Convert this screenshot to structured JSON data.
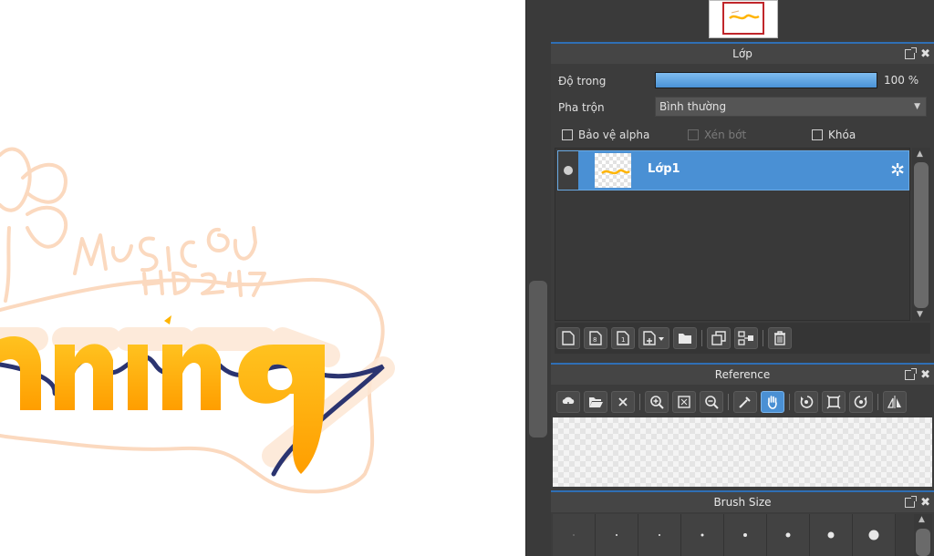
{
  "layer_panel": {
    "title": "Lớp",
    "opacity_label": "Độ trong",
    "opacity_value": "100 %",
    "opacity_level": 1.0,
    "blend_label": "Pha trộn",
    "blend_mode": "Bình thường",
    "protect_alpha_label": "Bảo vệ alpha",
    "clipping_label": "Xén bớt",
    "lock_label": "Khóa",
    "layers": [
      {
        "name": "Lớp1",
        "selected": true
      }
    ]
  },
  "reference_panel": {
    "title": "Reference"
  },
  "brush_panel": {
    "title": "Brush Size"
  },
  "colors": {
    "accent": "#4a90d4",
    "panel_bg": "#3c3c3c",
    "header_bg": "#454545",
    "lettering_yellow": "#ffb400",
    "lettering_navy": "#2b3470",
    "sketch_peach": "#fbd9bf"
  }
}
